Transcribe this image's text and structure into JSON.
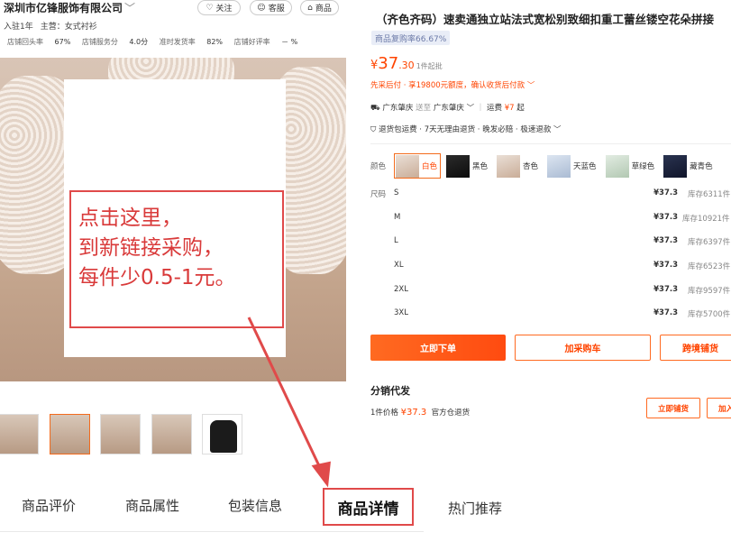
{
  "shop": {
    "name": "深圳市亿锋服饰有限公司",
    "years": "入驻1年",
    "main_business": "主营：女式衬衫",
    "follow_label": "关注",
    "service_label": "客服",
    "store_label": "商品",
    "stats": [
      {
        "label": "店铺回头率",
        "value": "67%"
      },
      {
        "label": "店铺服务分",
        "value": "4.0分"
      },
      {
        "label": "准时发货率",
        "value": "82%"
      },
      {
        "label": "店铺好评率",
        "value": "－ %"
      }
    ]
  },
  "promo_overlay": {
    "line1": "点击这里，",
    "line2": "到新链接采购，",
    "line3": "每件少0.5-1元。"
  },
  "tabs": [
    "商品评价",
    "商品属性",
    "包装信息",
    "商品详情",
    "热门推荐"
  ],
  "product": {
    "title": "（齐色齐码）速卖通独立站法式宽松别致细扣重工蕾丝镂空花朵拼接",
    "repurchase_badge": "商品复购率66.67%",
    "price_symbol": "¥",
    "price_int": "37",
    "price_dec": ".30",
    "moq": "1件起批",
    "credit": "先采后付 · 享19800元额度，确认收货后付款",
    "ship_from": "广东肇庆",
    "ship_to_word": "送至",
    "ship_to": "广东肇庆",
    "freight_label": "运费",
    "freight_value": "¥7",
    "freight_suffix": "起",
    "services": "退货包运费 · 7天无理由退货 · 晚发必赔 · 极速退款"
  },
  "color_label": "颜色",
  "colors": [
    "白色",
    "黑色",
    "杏色",
    "天蓝色",
    "草绿色",
    "藏青色"
  ],
  "size_label": "尺码",
  "sizes": [
    {
      "name": "S",
      "price": "¥37.3",
      "stock": "库存6311件"
    },
    {
      "name": "M",
      "price": "¥37.3",
      "stock": "库存10921件"
    },
    {
      "name": "L",
      "price": "¥37.3",
      "stock": "库存6397件"
    },
    {
      "name": "XL",
      "price": "¥37.3",
      "stock": "库存6523件"
    },
    {
      "name": "2XL",
      "price": "¥37.3",
      "stock": "库存9597件"
    },
    {
      "name": "3XL",
      "price": "¥37.3",
      "stock": "库存5700件"
    }
  ],
  "actions": {
    "buy": "立即下单",
    "cart": "加采购车",
    "cross": "跨境铺货"
  },
  "distribution": {
    "title": "分销代发",
    "price_label": "1件价格",
    "price": "¥37.3",
    "warehouse": "官方仓退货",
    "btn_list": "立即铺货",
    "btn_add": "加入铺货"
  },
  "colors_ui": {
    "accent": "#ff4400",
    "annotation": "#e04a4a"
  }
}
